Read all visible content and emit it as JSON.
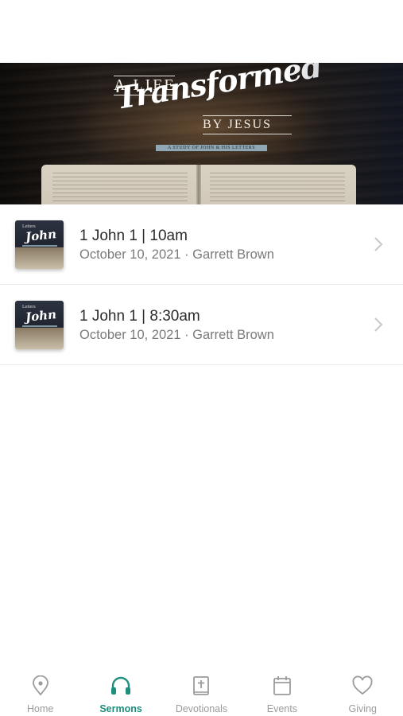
{
  "status": {
    "faint_text": ""
  },
  "hero": {
    "line1": "A LIFE",
    "line2": "Transformed",
    "line3": "BY JESUS",
    "subtitle": "A STUDY OF JOHN & HIS LETTERS"
  },
  "thumbnail": {
    "line1": "Letters",
    "line2": "John"
  },
  "sermons": [
    {
      "title": "1 John 1 | 10am",
      "subtitle": "October 10, 2021 · Garrett Brown"
    },
    {
      "title": "1 John 1 | 8:30am",
      "subtitle": "October 10, 2021 · Garrett Brown"
    }
  ],
  "tabs": [
    {
      "label": "Home",
      "icon": "location-pin-icon"
    },
    {
      "label": "Sermons",
      "icon": "headphones-icon",
      "active": true
    },
    {
      "label": "Devotionals",
      "icon": "bible-icon"
    },
    {
      "label": "Events",
      "icon": "calendar-icon"
    },
    {
      "label": "Giving",
      "icon": "heart-icon"
    }
  ],
  "colors": {
    "accent": "#1f8f7d",
    "inactive": "#9b9b9b"
  }
}
